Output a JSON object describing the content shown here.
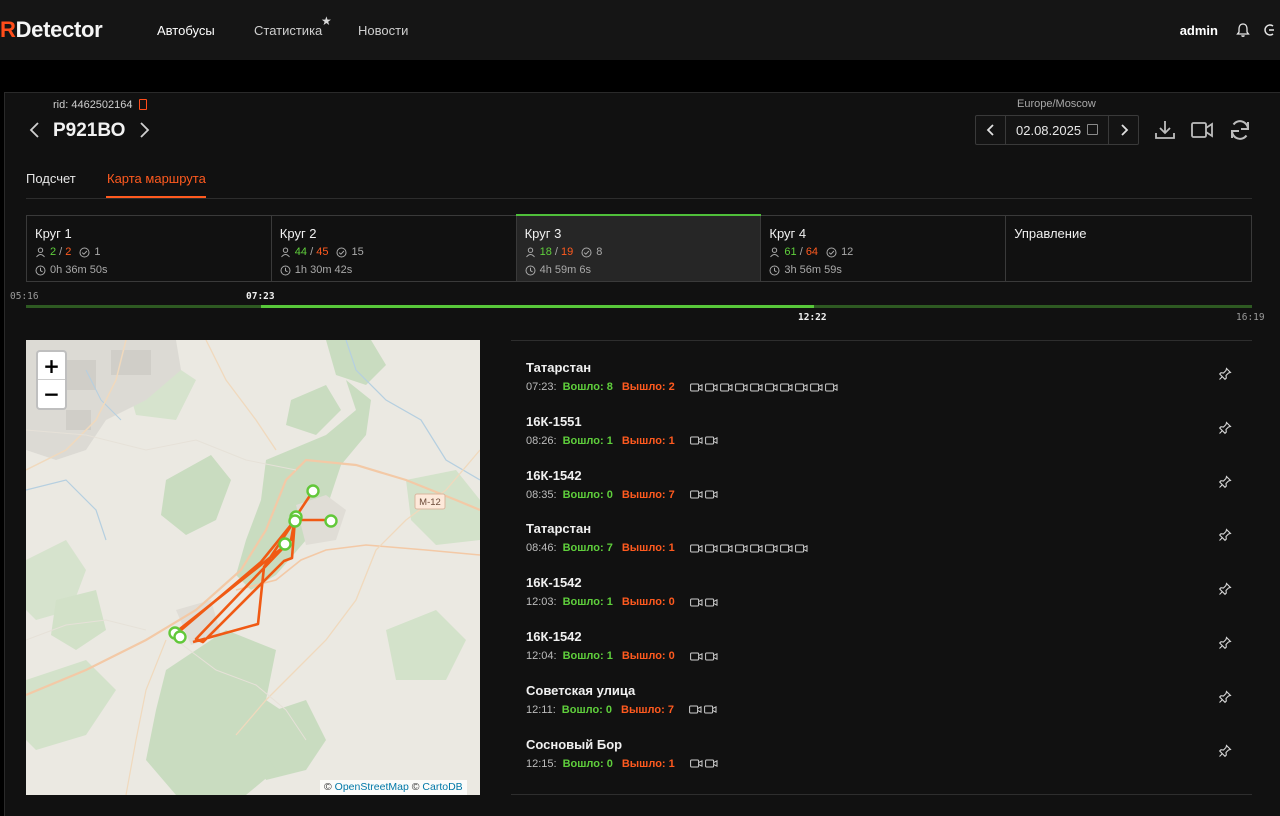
{
  "header": {
    "logo_r": "R",
    "logo_rest": "Detector",
    "nav": [
      "Автобусы",
      "Статистика",
      "Новости"
    ],
    "user": "admin"
  },
  "vehicle": {
    "rid": "rid: 4462502164",
    "plate": "Р921ВО"
  },
  "date_picker": {
    "timezone": "Europe/Moscow",
    "date": "02.08.2025"
  },
  "tabs": [
    "Подсчет",
    "Карта маршрута"
  ],
  "laps": [
    {
      "title": "Круг 1",
      "in": "2",
      "out": "2",
      "checks": "1",
      "duration": "0h 36m 50s"
    },
    {
      "title": "Круг 2",
      "in": "44",
      "out": "45",
      "checks": "15",
      "duration": "1h 30m 42s"
    },
    {
      "title": "Круг 3",
      "in": "18",
      "out": "19",
      "checks": "8",
      "duration": "4h 59m 6s"
    },
    {
      "title": "Круг 4",
      "in": "61",
      "out": "64",
      "checks": "12",
      "duration": "3h 56m 59s"
    }
  ],
  "management_label": "Управление",
  "timeline": {
    "start": "05:16",
    "sel_start": "07:23",
    "sel_end": "12:22",
    "end": "16:19",
    "progress_start_pct": 19.2,
    "progress_end_pct": 64.3
  },
  "map": {
    "zoom_in": "+",
    "zoom_out": "−",
    "road_label": "М-12",
    "attrib_copy": "©",
    "attrib_osm": "OpenStreetMap",
    "attrib_carto": "CartoDB"
  },
  "stops": [
    {
      "name": "Татарстан",
      "time": "07:23:",
      "in_label": "Вошло:",
      "in": "8",
      "out_label": "Вышло:",
      "out": "2",
      "cameras": 10
    },
    {
      "name": "16К-1551",
      "time": "08:26:",
      "in_label": "Вошло:",
      "in": "1",
      "out_label": "Вышло:",
      "out": "1",
      "cameras": 2
    },
    {
      "name": "16К-1542",
      "time": "08:35:",
      "in_label": "Вошло:",
      "in": "0",
      "out_label": "Вышло:",
      "out": "7",
      "cameras": 2
    },
    {
      "name": "Татарстан",
      "time": "08:46:",
      "in_label": "Вошло:",
      "in": "7",
      "out_label": "Вышло:",
      "out": "1",
      "cameras": 8
    },
    {
      "name": "16К-1542",
      "time": "12:03:",
      "in_label": "Вошло:",
      "in": "1",
      "out_label": "Вышло:",
      "out": "0",
      "cameras": 2
    },
    {
      "name": "16К-1542",
      "time": "12:04:",
      "in_label": "Вошло:",
      "in": "1",
      "out_label": "Вышло:",
      "out": "0",
      "cameras": 2
    },
    {
      "name": "Советская улица",
      "time": "12:11:",
      "in_label": "Вошло:",
      "in": "0",
      "out_label": "Вышло:",
      "out": "7",
      "cameras": 2
    },
    {
      "name": "Сосновый Бор",
      "time": "12:15:",
      "in_label": "Вошло:",
      "in": "0",
      "out_label": "Вышло:",
      "out": "1",
      "cameras": 2
    }
  ],
  "colors": {
    "accent": "#ff5a1f",
    "in_green": "#5fcf3c",
    "timeline_green": "#58c83a",
    "route": "#f05a14"
  }
}
